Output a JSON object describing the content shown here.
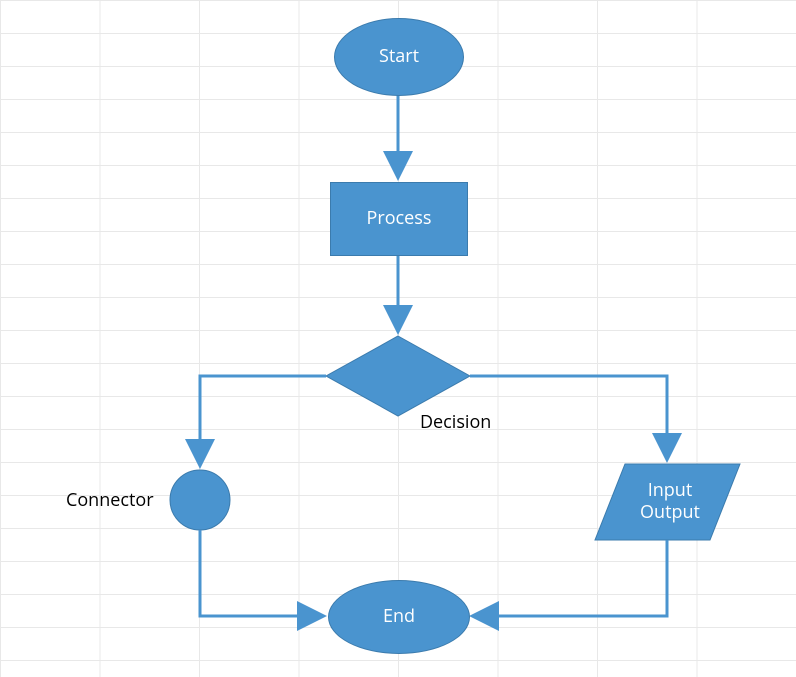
{
  "nodes": {
    "start": {
      "label": "Start"
    },
    "process": {
      "label": "Process"
    },
    "decision": {
      "label": "Decision"
    },
    "connector": {
      "label": "Connector"
    },
    "io": {
      "label": "Input Output"
    },
    "io_line1": "Input",
    "io_line2": "Output",
    "end": {
      "label": "End"
    }
  },
  "colors": {
    "shape_fill": "#4a94cf",
    "shape_stroke": "#3b7bad",
    "grid": "#e8e8e8"
  },
  "chart_data": {
    "type": "flowchart",
    "title": "",
    "nodes": [
      {
        "id": "start",
        "type": "terminator",
        "label": "Start"
      },
      {
        "id": "process",
        "type": "process",
        "label": "Process"
      },
      {
        "id": "decision",
        "type": "decision",
        "label": "Decision"
      },
      {
        "id": "connector",
        "type": "connector",
        "label": "Connector"
      },
      {
        "id": "io",
        "type": "input-output",
        "label": "Input Output"
      },
      {
        "id": "end",
        "type": "terminator",
        "label": "End"
      }
    ],
    "edges": [
      {
        "from": "start",
        "to": "process"
      },
      {
        "from": "process",
        "to": "decision"
      },
      {
        "from": "decision",
        "to": "connector",
        "branch": "left"
      },
      {
        "from": "decision",
        "to": "io",
        "branch": "right"
      },
      {
        "from": "connector",
        "to": "end"
      },
      {
        "from": "io",
        "to": "end"
      }
    ]
  }
}
